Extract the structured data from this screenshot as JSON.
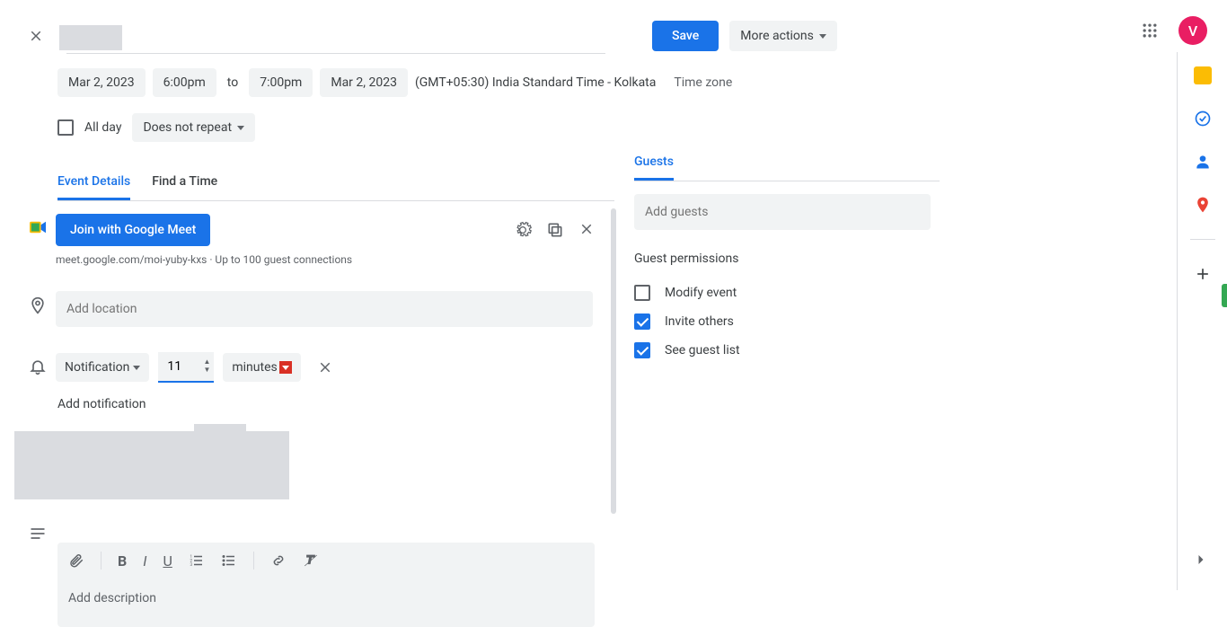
{
  "header": {
    "save_label": "Save",
    "more_actions_label": "More actions",
    "avatar_letter": "V"
  },
  "datetime": {
    "start_date": "Mar 2, 2023",
    "start_time": "6:00pm",
    "to_label": "to",
    "end_time": "7:00pm",
    "end_date": "Mar 2, 2023",
    "timezone_text": "(GMT+05:30) India Standard Time - Kolkata",
    "timezone_link": "Time zone"
  },
  "options": {
    "all_day_label": "All day",
    "all_day_checked": false,
    "repeat_label": "Does not repeat"
  },
  "tabs": {
    "event_details": "Event Details",
    "find_a_time": "Find a Time"
  },
  "meet": {
    "join_label": "Join with Google Meet",
    "link_text": "meet.google.com/moi-yuby-kxs · Up to 100 guest connections"
  },
  "location": {
    "placeholder": "Add location"
  },
  "notification": {
    "type_label": "Notification",
    "value": "11",
    "unit_label": "minutes",
    "add_label": "Add notification"
  },
  "description": {
    "placeholder": "Add description"
  },
  "guests": {
    "tab_label": "Guests",
    "input_placeholder": "Add guests",
    "permissions_title": "Guest permissions",
    "perms": [
      {
        "label": "Modify event",
        "checked": false
      },
      {
        "label": "Invite others",
        "checked": true
      },
      {
        "label": "See guest list",
        "checked": true
      }
    ]
  }
}
